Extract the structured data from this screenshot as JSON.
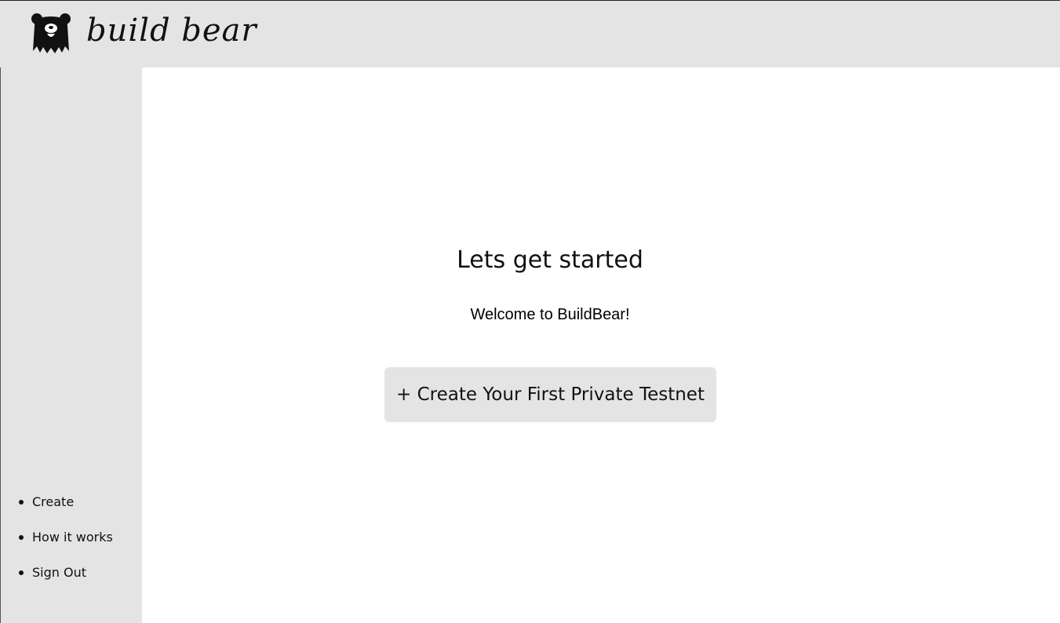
{
  "brand": {
    "name": "build bear",
    "logo_icon": "bear-head-icon"
  },
  "sidebar": {
    "items": [
      {
        "label": "Create"
      },
      {
        "label": "How it works"
      },
      {
        "label": "Sign Out"
      }
    ]
  },
  "main": {
    "title": "Lets get started",
    "welcome": "Welcome to BuildBear!",
    "create_button_label": "+ Create Your First Private Testnet"
  },
  "colors": {
    "panel_gray": "#e4e4e4",
    "background": "#ffffff",
    "text": "#111111"
  }
}
